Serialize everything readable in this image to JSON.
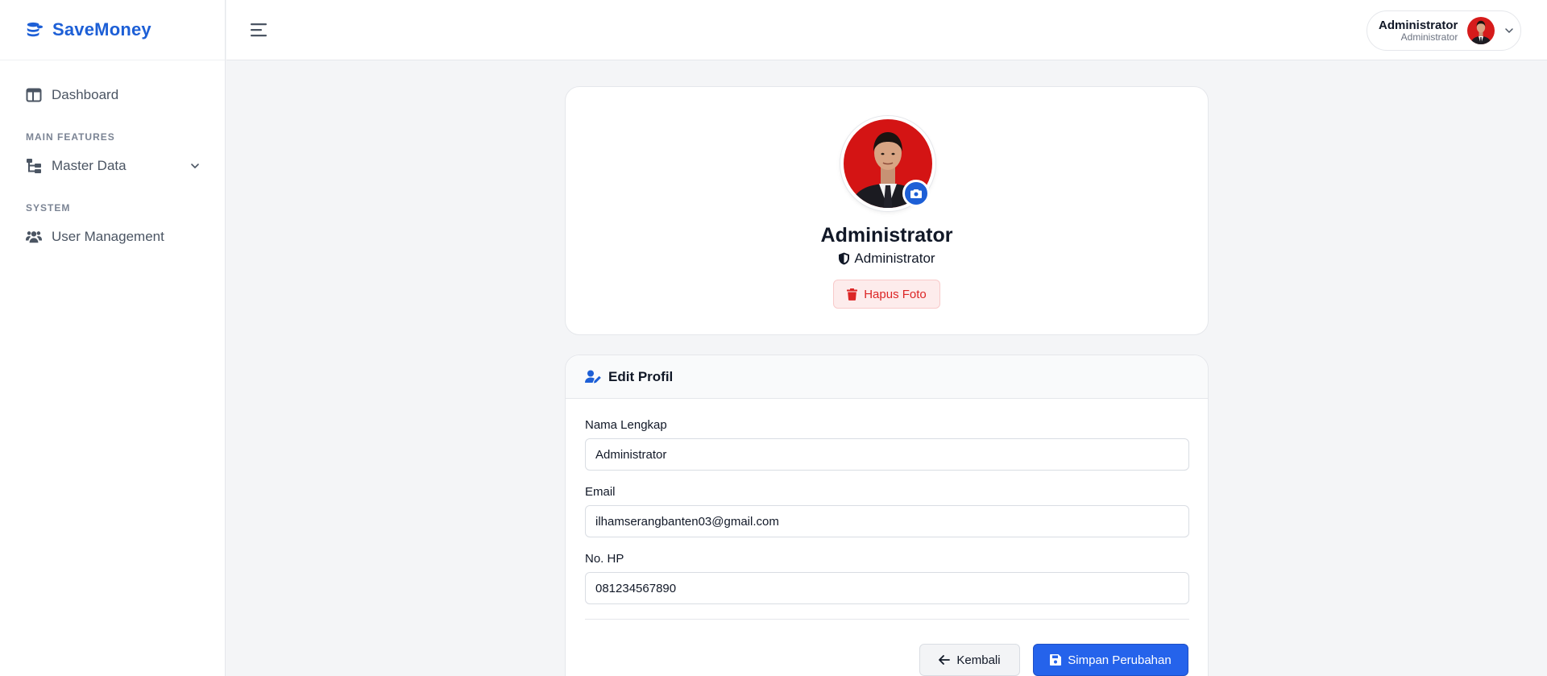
{
  "brand": {
    "name": "SaveMoney"
  },
  "sidebar": {
    "dashboard": "Dashboard",
    "sections": [
      {
        "title": "MAIN FEATURES",
        "item": "Master Data"
      },
      {
        "title": "SYSTEM",
        "item": "User Management"
      }
    ]
  },
  "header": {
    "user_name": "Administrator",
    "user_role": "Administrator"
  },
  "profile": {
    "name": "Administrator",
    "role": "Administrator",
    "delete_photo": "Hapus Foto"
  },
  "edit": {
    "title": "Edit Profil",
    "fields": [
      {
        "label": "Nama Lengkap",
        "value": "Administrator"
      },
      {
        "label": "Email",
        "value": "ilhamserangbanten03@gmail.com"
      },
      {
        "label": "No. HP",
        "value": "081234567890"
      }
    ],
    "back": "Kembali",
    "save": "Simpan Perubahan"
  },
  "colors": {
    "primary": "#1d5fd6",
    "danger": "#dc2626"
  }
}
